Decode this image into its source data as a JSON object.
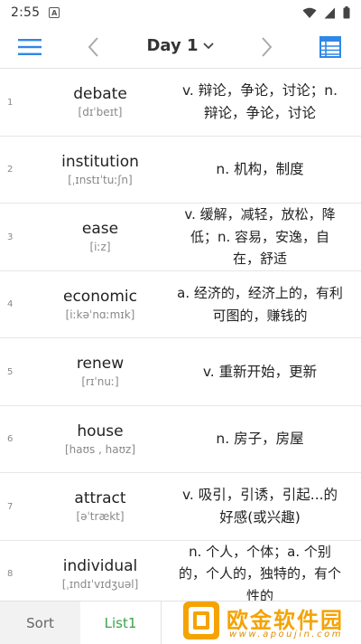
{
  "status_bar": {
    "time": "2:55"
  },
  "toolbar": {
    "title": "Day 1"
  },
  "words": [
    {
      "index": "1",
      "word": "debate",
      "phonetic": "[dɪˈbeɪt]",
      "meaning": "v. 辩论，争论，讨论；n. 辩论，争论，讨论"
    },
    {
      "index": "2",
      "word": "institution",
      "phonetic": "[ˌɪnstɪˈtuːʃn]",
      "meaning": "n. 机构，制度"
    },
    {
      "index": "3",
      "word": "ease",
      "phonetic": "[iːz]",
      "meaning": "v. 缓解，减轻，放松，降低；n. 容易，安逸，自在，舒适"
    },
    {
      "index": "4",
      "word": "economic",
      "phonetic": "[iːkəˈnɑːmɪk]",
      "meaning": "a. 经济的，经济上的，有利可图的，赚钱的"
    },
    {
      "index": "5",
      "word": "renew",
      "phonetic": "[rɪˈnuː]",
      "meaning": "v. 重新开始，更新"
    },
    {
      "index": "6",
      "word": "house",
      "phonetic": "[haʊs , haʊz]",
      "meaning": "n. 房子，房屋"
    },
    {
      "index": "7",
      "word": "attract",
      "phonetic": "[əˈtrækt]",
      "meaning": "v. 吸引，引诱，引起...的好感(或兴趣)"
    },
    {
      "index": "8",
      "word": "individual",
      "phonetic": "[ˌɪndɪˈvɪdʒuəl]",
      "meaning": "n. 个人，个体；a. 个别的，个人的，独特的，有个性的"
    }
  ],
  "bottom_tabs": {
    "sort": "Sort",
    "list1": "List1"
  },
  "watermark": {
    "brand": "欧金软件园",
    "url": "www.apoujin.com"
  },
  "colors": {
    "accent_blue": "#2f87e6",
    "tab_active_green": "#3aa34a",
    "watermark_orange": "#f5a300"
  }
}
